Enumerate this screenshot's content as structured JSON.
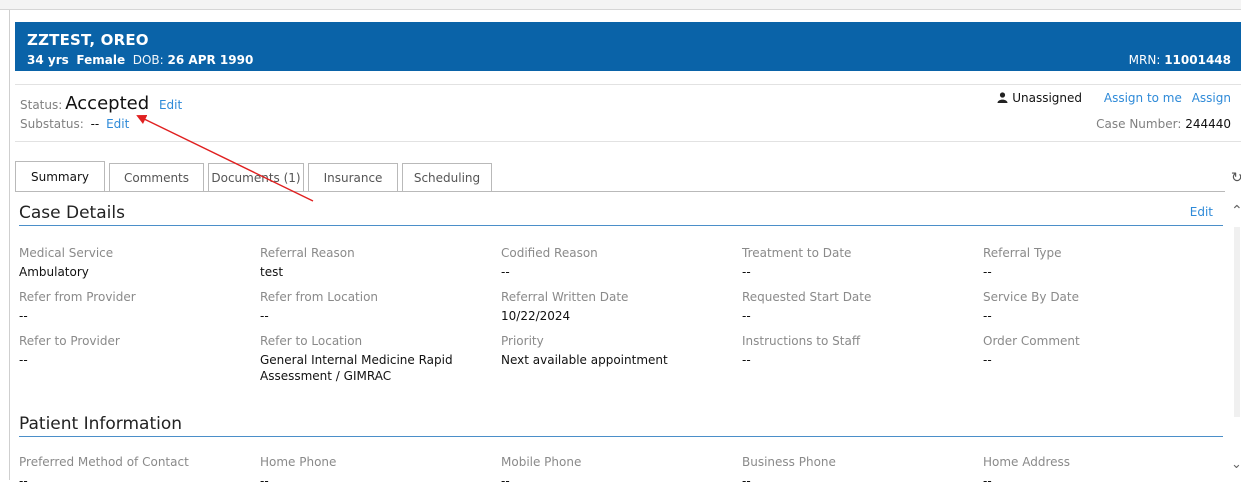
{
  "patient": {
    "name": "ZZTEST, OREO",
    "age": "34 yrs",
    "sex": "Female",
    "dob_label": "DOB:",
    "dob": "26 APR 1990",
    "mrn_label": "MRN:",
    "mrn": "11001448"
  },
  "status": {
    "label": "Status:",
    "value": "Accepted",
    "edit": "Edit",
    "substatus_label": "Substatus:",
    "substatus_value": "--",
    "substatus_edit": "Edit"
  },
  "assignment": {
    "assignee": "Unassigned",
    "assign_to_me": "Assign to me",
    "assign": "Assign",
    "case_number_label": "Case Number:",
    "case_number": "244440"
  },
  "tabs": [
    "Summary",
    "Comments",
    "Documents (1)",
    "Insurance",
    "Scheduling"
  ],
  "case_details": {
    "title": "Case Details",
    "edit": "Edit",
    "rows": [
      [
        {
          "label": "Medical Service",
          "value": "Ambulatory"
        },
        {
          "label": "Referral Reason",
          "value": "test"
        },
        {
          "label": "Codified Reason",
          "value": "--"
        },
        {
          "label": "Treatment to Date",
          "value": "--"
        },
        {
          "label": "Referral Type",
          "value": "--"
        }
      ],
      [
        {
          "label": "Refer from Provider",
          "value": "--"
        },
        {
          "label": "Refer from Location",
          "value": "--"
        },
        {
          "label": "Referral Written Date",
          "value": "10/22/2024"
        },
        {
          "label": "Requested Start Date",
          "value": "--"
        },
        {
          "label": "Service By Date",
          "value": "--"
        }
      ],
      [
        {
          "label": "Refer to Provider",
          "value": "--"
        },
        {
          "label": "Refer to Location",
          "value": "General Internal Medicine Rapid Assessment / GIMRAC"
        },
        {
          "label": "Priority",
          "value": "Next available appointment"
        },
        {
          "label": "Instructions to Staff",
          "value": "--"
        },
        {
          "label": "Order Comment",
          "value": "--"
        }
      ]
    ]
  },
  "patient_information": {
    "title": "Patient Information",
    "fields": [
      {
        "label": "Preferred Method of Contact",
        "value": "--"
      },
      {
        "label": "Home Phone",
        "value": "--"
      },
      {
        "label": "Mobile Phone",
        "value": "--"
      },
      {
        "label": "Business Phone",
        "value": "--"
      },
      {
        "label": "Home Address",
        "value": "--"
      }
    ]
  },
  "annotation_arrow_color": "#e02020",
  "banner_color": "#0a63a8",
  "link_color": "#2e8ad8"
}
